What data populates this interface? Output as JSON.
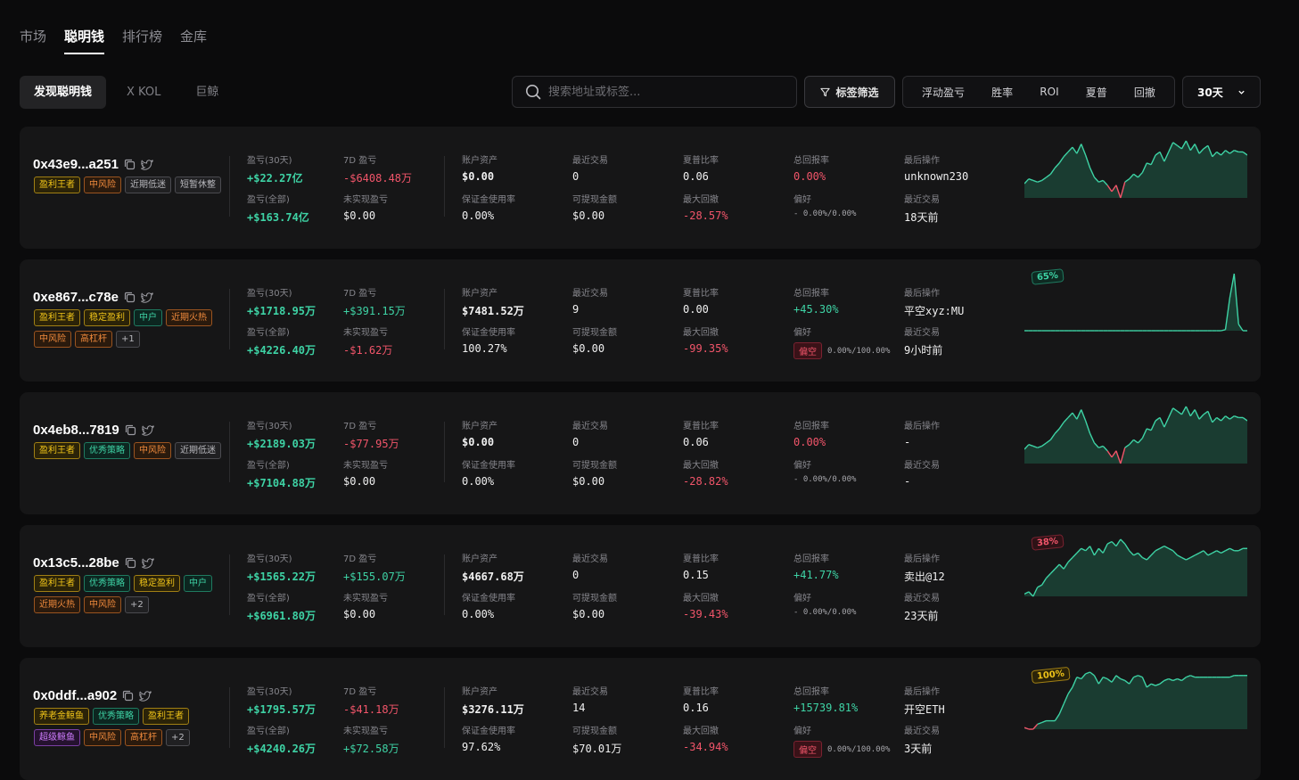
{
  "nav": {
    "tabs": [
      "市场",
      "聪明钱",
      "排行榜",
      "金库"
    ],
    "active": 1
  },
  "subnav": {
    "tabs": [
      "发现聪明钱",
      "X KOL",
      "巨鲸"
    ],
    "active": 0
  },
  "search": {
    "placeholder": "搜索地址或标签..."
  },
  "filter_label": "标签筛选",
  "sort_options": [
    "浮动盈亏",
    "胜率",
    "ROI",
    "夏普",
    "回撤"
  ],
  "period": "30天",
  "labels": {
    "pnl30": "盈亏(30天)",
    "pnl7": "7D 盈亏",
    "pnlall": "盈亏(全部)",
    "unreal": "未实现盈亏",
    "assets": "账户资产",
    "recent_trades": "最近交易",
    "sharpe": "夏普比率",
    "total_return": "总回报率",
    "last_op": "最后操作",
    "margin": "保证金使用率",
    "withdraw": "可提现金额",
    "maxdd": "最大回撤",
    "pref": "偏好",
    "last_trade": "最近交易"
  },
  "colors": {
    "green": "#3ed3a5",
    "red": "#f2556a",
    "gold": "#f0c419",
    "orange": "#f08a3c"
  },
  "cards": [
    {
      "address": "0x43e9...a251",
      "tags": [
        {
          "text": "盈利王者",
          "c": "gold"
        },
        {
          "text": "中风险",
          "c": "orange"
        },
        {
          "text": "近期低迷",
          "c": "gray"
        },
        {
          "text": "短暂休整",
          "c": "gray"
        }
      ],
      "pnl30": "+$22.27亿",
      "pnl7": "-$6408.48万",
      "pnlall": "+$163.74亿",
      "unreal": "$0.00",
      "assets": "$0.00",
      "recent_trades": "0",
      "sharpe": "0.06",
      "total_return": "0.00%",
      "last_op": "unknown230",
      "margin": "0.00%",
      "withdraw": "$0.00",
      "maxdd": "-28.57%",
      "pref_badge": "",
      "pref_value": "- 0.00%/0.00%",
      "last_trade": "18天前",
      "chart": {
        "badge": "",
        "badge_color": "",
        "values": [
          2,
          5,
          4,
          3,
          4,
          6,
          8,
          12,
          15,
          19,
          22,
          25,
          21,
          27,
          20,
          12,
          6,
          3,
          4,
          1,
          -3,
          1,
          -7,
          3,
          5,
          8,
          6,
          9,
          15,
          14,
          20,
          22,
          16,
          22,
          28,
          26,
          24,
          29,
          23,
          27,
          21,
          24,
          26,
          19,
          22,
          20,
          23,
          21,
          23,
          22,
          22,
          20
        ]
      }
    },
    {
      "address": "0xe867...c78e",
      "tags": [
        {
          "text": "盈利王者",
          "c": "gold"
        },
        {
          "text": "稳定盈利",
          "c": "gold"
        },
        {
          "text": "中户",
          "c": "teal"
        },
        {
          "text": "近期火热",
          "c": "orange"
        },
        {
          "text": "中风险",
          "c": "orange"
        },
        {
          "text": "高杠杆",
          "c": "orange"
        },
        {
          "text": "+1",
          "c": "gray"
        }
      ],
      "pnl30": "+$1718.95万",
      "pnl7": "+$391.15万",
      "pnlall": "+$4226.40万",
      "unreal": "-$1.62万",
      "assets": "$7481.52万",
      "recent_trades": "9",
      "sharpe": "0.00",
      "total_return": "+45.30%",
      "last_op": "平空xyz:MU",
      "margin": "100.27%",
      "withdraw": "$0.00",
      "maxdd": "-99.35%",
      "pref_badge": "偏空",
      "pref_value": "0.00%/100.00%",
      "last_trade": "9小时前",
      "chart": {
        "badge": "65%",
        "badge_color": "green",
        "values": [
          0,
          0,
          0,
          0,
          0,
          0,
          0,
          0,
          0,
          0,
          0,
          0,
          0,
          0,
          0,
          0,
          0,
          0,
          0,
          0,
          0,
          0,
          0,
          0,
          0,
          0,
          0,
          0,
          0,
          0,
          0,
          0,
          0,
          0,
          0,
          0,
          0,
          0,
          0,
          0,
          0,
          0,
          0,
          0,
          0,
          0,
          0.5,
          15,
          26,
          3,
          0,
          0
        ]
      }
    },
    {
      "address": "0x4eb8...7819",
      "tags": [
        {
          "text": "盈利王者",
          "c": "gold"
        },
        {
          "text": "优秀策略",
          "c": "teal"
        },
        {
          "text": "中风险",
          "c": "orange"
        },
        {
          "text": "近期低迷",
          "c": "gray"
        }
      ],
      "pnl30": "+$2189.03万",
      "pnl7": "-$77.95万",
      "pnlall": "+$7104.88万",
      "unreal": "$0.00",
      "assets": "$0.00",
      "recent_trades": "0",
      "sharpe": "0.06",
      "total_return": "0.00%",
      "last_op": "-",
      "margin": "0.00%",
      "withdraw": "$0.00",
      "maxdd": "-28.82%",
      "pref_badge": "",
      "pref_value": "- 0.00%/0.00%",
      "last_trade": "-",
      "chart": {
        "badge": "",
        "badge_color": "",
        "values": [
          2,
          5,
          4,
          3,
          4,
          6,
          8,
          12,
          15,
          19,
          22,
          25,
          21,
          27,
          20,
          12,
          6,
          3,
          4,
          1,
          -3,
          1,
          -7,
          3,
          5,
          8,
          6,
          9,
          15,
          14,
          20,
          22,
          16,
          22,
          28,
          26,
          24,
          29,
          23,
          27,
          21,
          24,
          26,
          19,
          22,
          20,
          23,
          21,
          23,
          22,
          22,
          20
        ]
      }
    },
    {
      "address": "0x13c5...28be",
      "tags": [
        {
          "text": "盈利王者",
          "c": "gold"
        },
        {
          "text": "优秀策略",
          "c": "teal"
        },
        {
          "text": "稳定盈利",
          "c": "gold"
        },
        {
          "text": "中户",
          "c": "teal"
        },
        {
          "text": "近期火热",
          "c": "orange"
        },
        {
          "text": "中风险",
          "c": "orange"
        },
        {
          "text": "+2",
          "c": "gray"
        }
      ],
      "pnl30": "+$1565.22万",
      "pnl7": "+$155.07万",
      "pnlall": "+$6961.80万",
      "unreal": "$0.00",
      "assets": "$4667.68万",
      "recent_trades": "0",
      "sharpe": "0.15",
      "total_return": "+41.77%",
      "last_op": "卖出@12",
      "margin": "0.00%",
      "withdraw": "$0.00",
      "maxdd": "-39.43%",
      "pref_badge": "",
      "pref_value": "- 0.00%/0.00%",
      "last_trade": "23天前",
      "chart": {
        "badge": "38%",
        "badge_color": "red",
        "values": [
          1,
          2,
          0,
          4,
          5,
          8,
          10,
          12,
          14,
          12,
          15,
          17,
          19,
          21,
          20,
          22,
          18,
          21,
          19,
          23,
          24,
          22,
          25,
          23,
          20,
          18,
          19,
          17,
          16,
          18,
          20,
          21,
          22,
          21,
          20,
          18,
          17,
          16,
          17,
          18,
          19,
          20,
          18,
          19,
          20,
          19,
          20,
          21,
          20,
          20,
          21,
          21
        ]
      }
    },
    {
      "address": "0x0ddf...a902",
      "tags": [
        {
          "text": "养老金鲸鱼",
          "c": "gold"
        },
        {
          "text": "优秀策略",
          "c": "teal"
        },
        {
          "text": "盈利王者",
          "c": "gold"
        },
        {
          "text": "超级鲸鱼",
          "c": "purple"
        },
        {
          "text": "中风险",
          "c": "orange"
        },
        {
          "text": "高杠杆",
          "c": "orange"
        },
        {
          "text": "+2",
          "c": "gray"
        }
      ],
      "pnl30": "+$1795.57万",
      "pnl7": "-$41.18万",
      "pnlall": "+$4240.26万",
      "unreal": "+$72.58万",
      "assets": "$3276.11万",
      "recent_trades": "14",
      "sharpe": "0.16",
      "total_return": "+15739.81%",
      "last_op": "开空ETH",
      "margin": "97.62%",
      "withdraw": "$70.01万",
      "maxdd": "-34.94%",
      "pref_badge": "偏空",
      "pref_value": "0.00%/100.00%",
      "last_trade": "3天前",
      "chart": {
        "badge": "100%",
        "badge_color": "gold",
        "values": [
          0,
          -1,
          -1,
          2,
          3,
          4,
          4,
          4,
          8,
          14,
          20,
          24,
          30,
          29,
          32,
          33,
          31,
          26,
          30,
          29,
          27,
          31,
          29,
          28,
          26,
          30,
          31,
          30,
          24,
          26,
          25,
          26,
          28,
          29,
          28,
          29,
          28,
          30,
          31,
          30,
          30,
          30,
          30,
          30,
          30,
          30,
          30,
          30,
          31,
          31,
          31,
          31
        ]
      }
    }
  ]
}
